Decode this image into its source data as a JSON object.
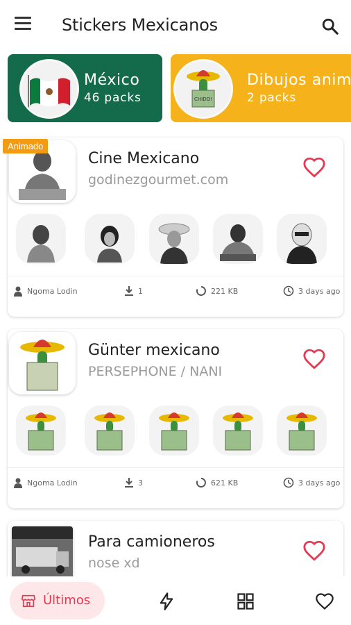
{
  "appbar": {
    "title": "Stickers Mexicanos",
    "menu_icon": "hamburger-menu-icon",
    "search_icon": "search-icon"
  },
  "categories": [
    {
      "name": "México",
      "count": "46 packs",
      "color": "#136b4b"
    },
    {
      "name": "Dibujos animados",
      "count": "2 packs",
      "color": "#f6b21b"
    }
  ],
  "packs": [
    {
      "badge": "Animado",
      "title": "Cine Mexicano",
      "subtitle": "godinezgourmet.com",
      "author": "Ngoma Lodin",
      "downloads": "1",
      "size": "221 KB",
      "age": "3 days ago"
    },
    {
      "badge": "",
      "title": "Günter mexicano",
      "subtitle": "PERSEPHONE / NANI",
      "author": "Ngoma Lodin",
      "downloads": "3",
      "size": "621 KB",
      "age": "3 days ago"
    },
    {
      "badge": "",
      "title": "Para camioneros",
      "subtitle": "nose xd"
    }
  ],
  "bottom_nav": {
    "active_label": "Últimos",
    "items": [
      "store-icon",
      "bolt-icon",
      "grid-icon",
      "heart-icon"
    ]
  },
  "colors": {
    "accent": "#e63a53",
    "badge": "#f39c12",
    "green_card": "#136b4b",
    "yellow_card": "#f6b21b"
  }
}
